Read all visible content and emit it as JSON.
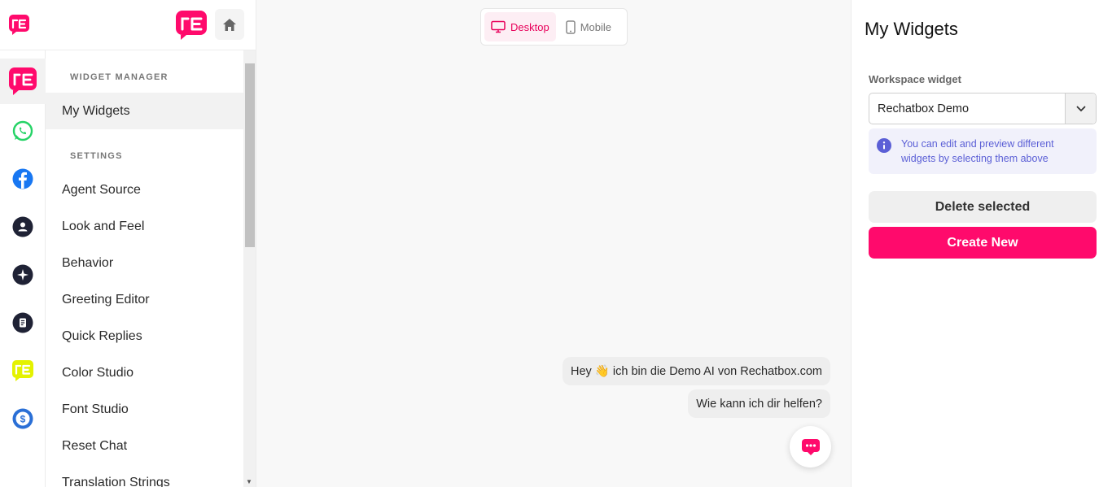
{
  "header": {
    "logo_icon": "rechatbox-logo-icon",
    "home_icon": "home-icon"
  },
  "rail": {
    "items": [
      {
        "icon": "rechatbox-logo-icon",
        "color": "#ff0a6c"
      },
      {
        "icon": "whatsapp-icon",
        "color": "#25d366"
      },
      {
        "icon": "facebook-icon",
        "color": "#1877f2"
      },
      {
        "icon": "user-circle-icon",
        "color": "#1f2235"
      },
      {
        "icon": "sparkle-icon",
        "color": "#1f2235"
      },
      {
        "icon": "document-icon",
        "color": "#1f2235"
      },
      {
        "icon": "rechatbox-logo-icon",
        "color": "#e4f200"
      },
      {
        "icon": "dollar-icon",
        "color": "#2a6fd6"
      }
    ]
  },
  "menu": {
    "widget_manager_label": "WIDGET MANAGER",
    "settings_label": "SETTINGS",
    "items": [
      {
        "label": "My Widgets"
      },
      {
        "label": "Agent Source"
      },
      {
        "label": "Look and Feel"
      },
      {
        "label": "Behavior"
      },
      {
        "label": "Greeting Editor"
      },
      {
        "label": "Quick Replies"
      },
      {
        "label": "Color Studio"
      },
      {
        "label": "Font Studio"
      },
      {
        "label": "Reset Chat"
      },
      {
        "label": "Translation Strings"
      }
    ]
  },
  "preview": {
    "desktop_label": "Desktop",
    "mobile_label": "Mobile",
    "messages": [
      "Hey 👋 ich bin die Demo AI von Rechatbox.com",
      "Wie kann ich dir helfen?"
    ]
  },
  "panel": {
    "title": "My Widgets",
    "workspace_label": "Workspace widget",
    "selected_widget": "Rechatbox Demo",
    "info_text": "You can edit and preview different widgets by selecting them above",
    "delete_label": "Delete selected",
    "create_label": "Create New"
  },
  "colors": {
    "brand": "#ff0a6c",
    "info": "#5b5fd6"
  }
}
